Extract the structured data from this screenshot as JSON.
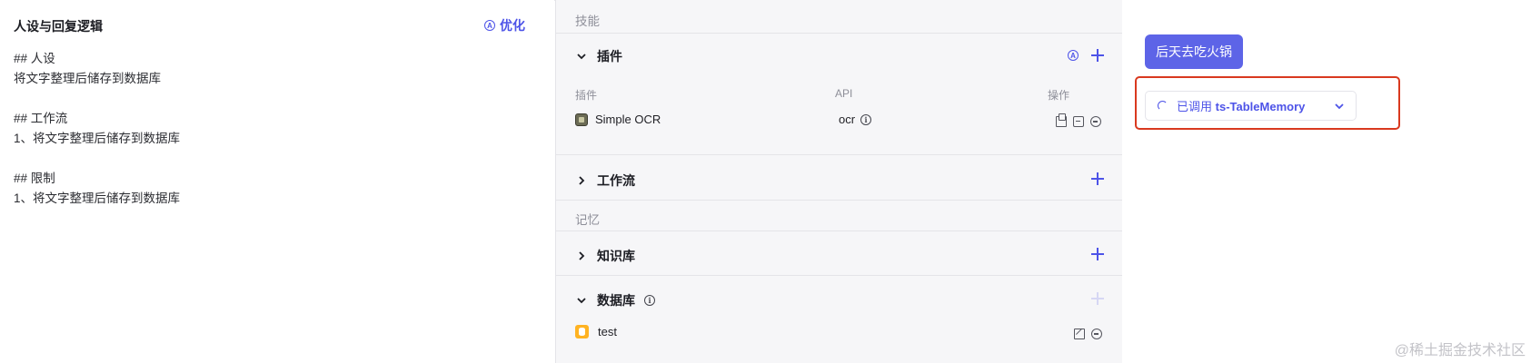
{
  "left": {
    "title": "人设与回复逻辑",
    "optimize_label": "优化",
    "prompt_lines": [
      "## 人设",
      "将文字整理后储存到数据库",
      "",
      "## 工作流",
      "1、将文字整理后储存到数据库",
      "",
      "## 限制",
      "1、将文字整理后储存到数据库"
    ]
  },
  "middle": {
    "skills_label": "技能",
    "plugins": {
      "title": "插件",
      "col_plugin": "插件",
      "col_api": "API",
      "col_ops": "操作",
      "rows": [
        {
          "name": "Simple OCR",
          "api": "ocr"
        }
      ]
    },
    "workflow_title": "工作流",
    "memory_label": "记忆",
    "knowledge_title": "知识库",
    "database": {
      "title": "数据库",
      "rows": [
        {
          "name": "test"
        }
      ]
    }
  },
  "right": {
    "user_message": "后天去吃火锅",
    "call_prefix": "已调用",
    "call_name": "ts-TableMemory"
  },
  "watermark": "@稀土掘金技术社区",
  "colors": {
    "accent": "#4d53e8",
    "user_bubble": "#5d64e7",
    "highlight": "#d9391f",
    "db_icon": "#ffb322"
  }
}
